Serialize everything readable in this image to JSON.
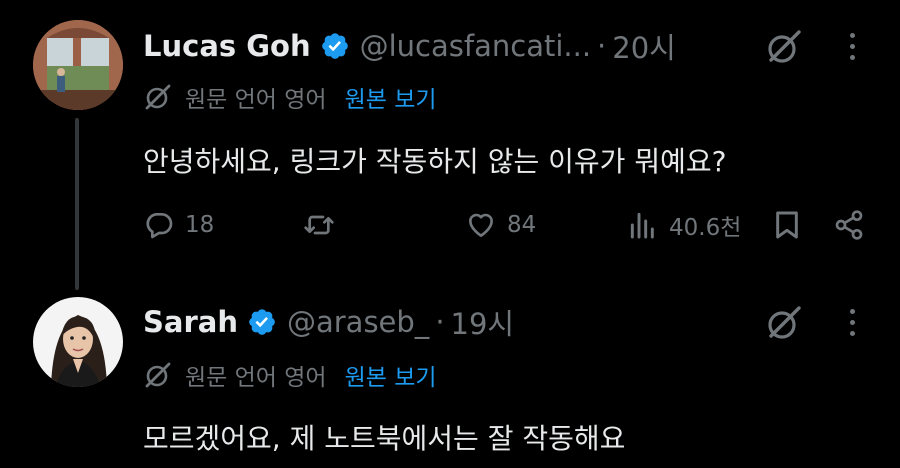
{
  "posts": [
    {
      "author_name": "Lucas Goh",
      "handle": "@lucasfancati...",
      "time": "20시",
      "translated_label": "원문 언어 영어",
      "show_original_link": "원본 보기",
      "text": "안녕하세요, 링크가 작동하지 않는 이유가 뭐예요?",
      "actions": {
        "replies": "18",
        "reposts": "",
        "likes": "84",
        "views": "40.6천"
      }
    },
    {
      "author_name": "Sarah",
      "handle": "@araseb_",
      "time": "19시",
      "translated_label": "원문 언어 영어",
      "show_original_link": "원본 보기",
      "text": "모르겠어요, 제 노트북에서는 잘 작동해요"
    }
  ],
  "colors": {
    "background": "#000000",
    "text": "#e7e9ea",
    "muted": "#71767b",
    "accent": "#1d9bf0",
    "thread_line": "#333639"
  },
  "icons": {
    "verified": "verified-badge-icon",
    "grok": "grok-icon",
    "more": "more-icon",
    "translate": "translate-icon",
    "reply": "reply-icon",
    "repost": "repost-icon",
    "like": "heart-icon",
    "views": "views-icon",
    "bookmark": "bookmark-icon",
    "share": "share-icon"
  }
}
